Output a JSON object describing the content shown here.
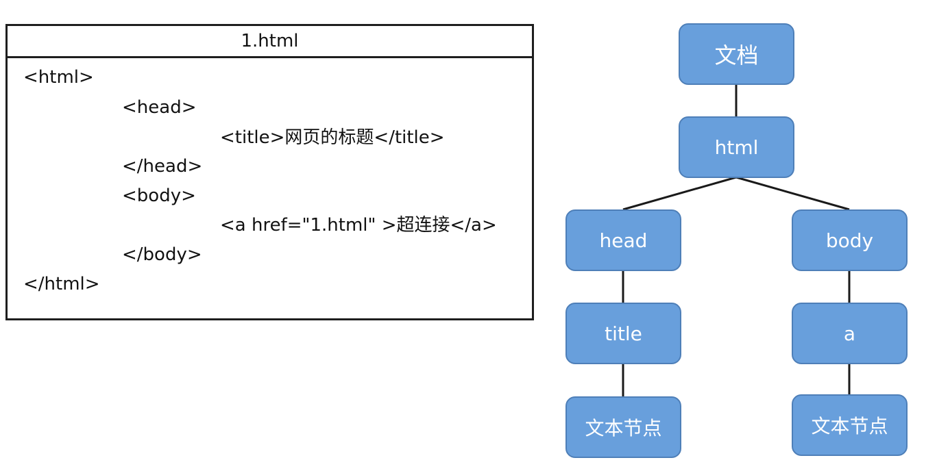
{
  "code_panel": {
    "title": "1.html",
    "lines": [
      "<html>",
      "<head>",
      "<title>网页的标题</title>",
      "</head>",
      "<body>",
      "<a href=\"1.html\" >超连接</a>",
      "</body>",
      "</html>"
    ]
  },
  "tree": {
    "node_color": "#689fdc",
    "nodes": {
      "document": "文档",
      "html": "html",
      "head": "head",
      "body": "body",
      "title": "title",
      "a": "a",
      "title_text": "文本节点",
      "a_text": "文本节点"
    },
    "edges": [
      [
        "document",
        "html"
      ],
      [
        "html",
        "head"
      ],
      [
        "html",
        "body"
      ],
      [
        "head",
        "title"
      ],
      [
        "body",
        "a"
      ],
      [
        "title",
        "title_text"
      ],
      [
        "a",
        "a_text"
      ]
    ]
  }
}
